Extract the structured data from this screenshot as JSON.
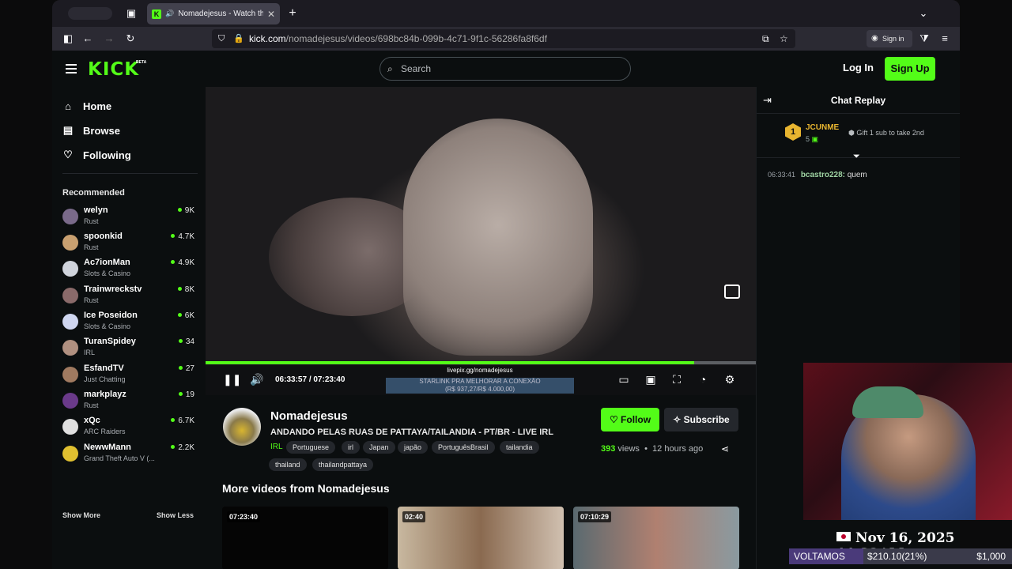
{
  "browser": {
    "tab_title": "Nomadejesus - Watch the V",
    "url_host": "kick.com",
    "url_path": "/nomadejesus/videos/698bc84b-099b-4c71-9f1c-56286fa8f6df",
    "signin_label": "Sign in"
  },
  "header": {
    "logo": "KICK",
    "beta": "BETA",
    "search_placeholder": "Search",
    "login_label": "Log In",
    "signup_label": "Sign Up"
  },
  "sidebar": {
    "nav": [
      {
        "label": "Home",
        "icon": "home-icon"
      },
      {
        "label": "Browse",
        "icon": "browse-icon"
      },
      {
        "label": "Following",
        "icon": "heart-icon"
      }
    ],
    "recommended_title": "Recommended",
    "recommended": [
      {
        "name": "welyn",
        "category": "Rust",
        "viewers": "9K"
      },
      {
        "name": "spoonkid",
        "category": "Rust",
        "viewers": "4.7K"
      },
      {
        "name": "Ac7ionMan",
        "category": "Slots & Casino",
        "viewers": "4.9K"
      },
      {
        "name": "Trainwreckstv",
        "category": "Rust",
        "viewers": "8K"
      },
      {
        "name": "Ice Poseidon",
        "category": "Slots & Casino",
        "viewers": "6K"
      },
      {
        "name": "TuranSpidey",
        "category": "IRL",
        "viewers": "34"
      },
      {
        "name": "EsfandTV",
        "category": "Just Chatting",
        "viewers": "27"
      },
      {
        "name": "markplayz",
        "category": "Rust",
        "viewers": "19"
      },
      {
        "name": "xQc",
        "category": "ARC Raiders",
        "viewers": "6.7K"
      },
      {
        "name": "NewwMann",
        "category": "Grand Theft Auto V (...",
        "viewers": "2.2K"
      }
    ],
    "show_more": "Show More",
    "show_less": "Show Less"
  },
  "player": {
    "current_time": "06:33:57",
    "separator": "/",
    "duration": "07:23:40",
    "progress_fraction": 0.888,
    "overlay_line1": "livepix.gg/nomadejesus",
    "overlay_line2": "STARLINK PRA MELHORAR A CONEXÃO",
    "overlay_line3": "(R$ 937,27/R$ 4.000,00)"
  },
  "video_info": {
    "channel_name": "Nomadejesus",
    "title": "ANDANDO PELAS RUAS DE PATTAYA/TAILANDIA - PT/BR - LIVE IRL",
    "category": "IRL",
    "tags_row1": [
      "Portuguese",
      "irl",
      "Japan",
      "japão",
      "PortuguêsBrasil",
      "tailandia"
    ],
    "tags_row2": [
      "thailand",
      "thailandpattaya"
    ],
    "follow_label": "Follow",
    "subscribe_label": "Subscribe",
    "views": "393",
    "views_label": "views",
    "dot": "•",
    "age": "12 hours ago",
    "more_videos_title": "More videos from Nomadejesus",
    "thumbnails": [
      {
        "duration": "07:23:40"
      },
      {
        "duration": "02:40"
      },
      {
        "duration": "07:10:29"
      }
    ]
  },
  "chat": {
    "title": "Chat Replay",
    "top_gifter_rank": "1",
    "top_gifter_name": "JCUNME",
    "top_gifter_count": "5",
    "gift_prompt": "Gift 1 sub to take 2nd",
    "messages": [
      {
        "time": "06:33:41",
        "user": "bcastro228:",
        "text": "quem"
      }
    ]
  },
  "stream_overlay": {
    "date": "Nov 16, 2025 11:32AM",
    "ticker_left": "VOLTAMOS",
    "ticker_mid": "$210.10(21%)",
    "ticker_right": "$1,000"
  },
  "colors": {
    "accent": "#53fc18",
    "background": "#0b0e0f",
    "gold": "#e8b530"
  }
}
